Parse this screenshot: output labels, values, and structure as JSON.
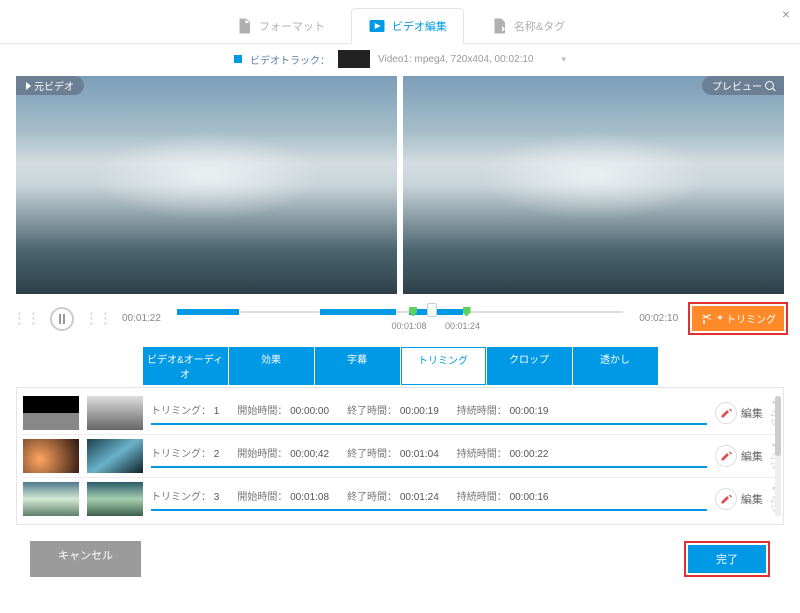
{
  "close_icon": "×",
  "nav": {
    "format": "フォーマット",
    "edit": "ビデオ編集",
    "name_tag": "名称&タグ"
  },
  "track": {
    "label": "ビデオトラック：",
    "info": "Video1: mpeg4, 720x404, 00:02:10"
  },
  "badges": {
    "source": "元ビデオ",
    "preview": "プレビュー"
  },
  "player": {
    "current": "00:01:22",
    "total": "00:02:10",
    "marker_start": "00:01:08",
    "marker_end": "00:01:24"
  },
  "trim_button": "トリミング",
  "subtabs": {
    "video_audio": "ビデオ&オーディオ",
    "effect": "効果",
    "subtitle": "字幕",
    "trimming": "トリミング",
    "crop": "クロップ",
    "watermark": "透かし"
  },
  "labels": {
    "trim": "トリミング：",
    "start": "開始時間：",
    "end": "終了時間：",
    "duration": "持続時間：",
    "edit": "編集"
  },
  "rows": [
    {
      "n": "1",
      "start": "00:00:00",
      "end": "00:00:19",
      "dur": "00:00:19"
    },
    {
      "n": "2",
      "start": "00:00:42",
      "end": "00:01:04",
      "dur": "00:00:22"
    },
    {
      "n": "3",
      "start": "00:01:08",
      "end": "00:01:24",
      "dur": "00:00:16"
    }
  ],
  "footer": {
    "cancel": "キャンセル",
    "done": "完了"
  }
}
